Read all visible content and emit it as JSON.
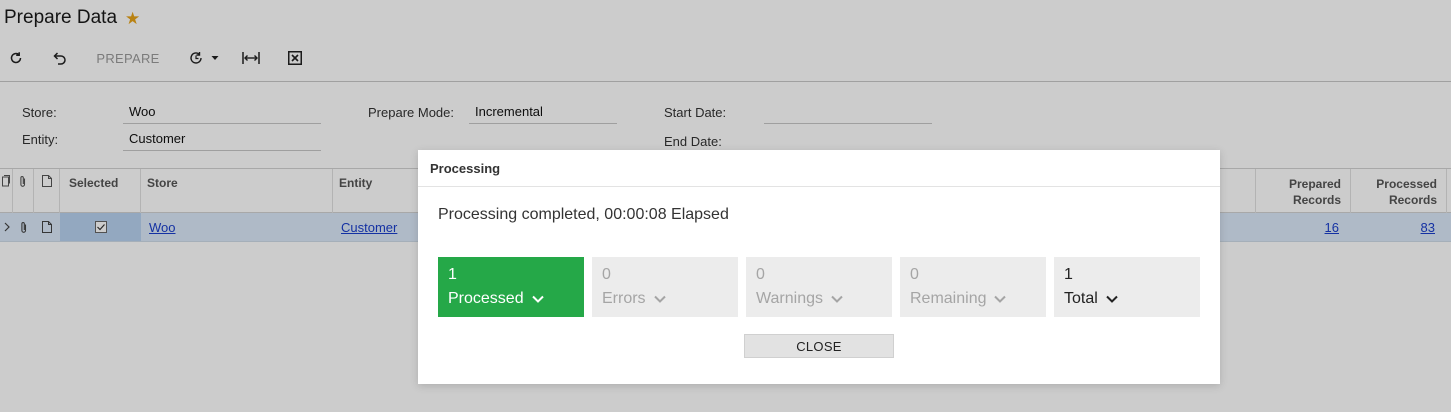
{
  "page": {
    "title": "Prepare Data"
  },
  "toolbar": {
    "prepare_label": "PREPARE"
  },
  "form": {
    "store_label": "Store:",
    "store_value": "Woo",
    "entity_label": "Entity:",
    "entity_value": "Customer",
    "prepare_mode_label": "Prepare Mode:",
    "prepare_mode_value": "Incremental",
    "start_date_label": "Start Date:",
    "start_date_value": "",
    "end_date_label": "End Date:"
  },
  "grid": {
    "columns": {
      "selected": "Selected",
      "store": "Store",
      "entity": "Entity",
      "prepared_records_1": "Prepared",
      "prepared_records_2": "Records",
      "processed_records_1": "Processed",
      "processed_records_2": "Records"
    },
    "rows": [
      {
        "store": "Woo",
        "entity": "Customer",
        "prepared_records": "16",
        "processed_records": "83"
      }
    ]
  },
  "dialog": {
    "title": "Processing",
    "message": "Processing completed, 00:00:08 Elapsed",
    "tiles": [
      {
        "count": "1",
        "label": "Processed"
      },
      {
        "count": "0",
        "label": "Errors"
      },
      {
        "count": "0",
        "label": "Warnings"
      },
      {
        "count": "0",
        "label": "Remaining"
      },
      {
        "count": "1",
        "label": "Total"
      }
    ],
    "close_label": "CLOSE"
  },
  "colors": {
    "accent_green": "#25a848",
    "star": "#e8a317",
    "selected_row": "#dbe9f9",
    "link": "#1a3ecc"
  }
}
